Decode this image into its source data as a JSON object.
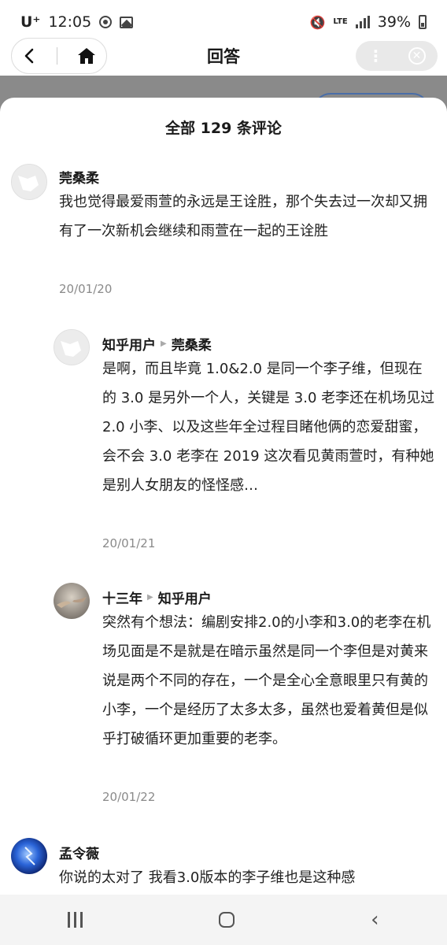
{
  "status_bar": {
    "carrier": "U⁺",
    "time": "12:05",
    "network": "LTE",
    "battery": "39%"
  },
  "nav": {
    "title": "回答"
  },
  "sheet": {
    "title": "全部 129 条评论"
  },
  "comments": [
    {
      "author": "莞桑柔",
      "reply_to": "",
      "text": "我也觉得最爱雨萱的永远是王诠胜，那个失去过一次却又拥有了一次新机会继续和雨萱在一起的王诠胜",
      "date": "20/01/20"
    },
    {
      "author": "知乎用户",
      "reply_to": "莞桑柔",
      "text": "是啊，而且毕竟 1.0&2.0 是同一个李子维，但现在的 3.0 是另外一个人，关键是 3.0 老李还在机场见过 2.0 小李、以及这些年全过程目睹他俩的恋爱甜蜜，会不会 3.0 老李在 2019 这次看见黄雨萱时，有种她是别人女朋友的怪怪感…",
      "date": "20/01/21"
    },
    {
      "author": "十三年",
      "reply_to": "知乎用户",
      "text": "突然有个想法：编剧安排2.0的小李和3.0的老李在机场见面是不是就是在暗示虽然是同一个李但是对黄来说是两个不同的存在，一个是全心全意眼里只有黄的小李，一个是经历了太多太多，虽然也爱着黄但是似乎打破循环更加重要的老李。",
      "date": "20/01/22"
    },
    {
      "author": "孟令薇",
      "reply_to": "",
      "text": "你说的太对了 我看3.0版本的李子维也是这种感",
      "date": ""
    }
  ],
  "colors": {
    "accent_outline": "#4a6ea8",
    "dim_overlay": "#8a8a8a"
  }
}
